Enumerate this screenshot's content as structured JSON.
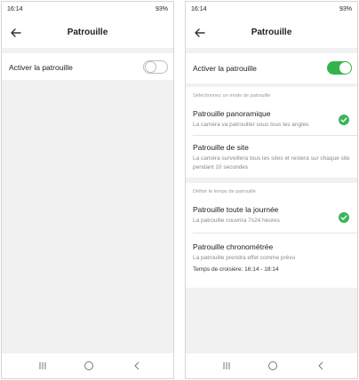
{
  "left": {
    "status": {
      "time": "16:14",
      "right": "93%"
    },
    "header": {
      "title": "Patrouille"
    },
    "patrol_toggle": {
      "label": "Activer la patrouille",
      "state": "off"
    }
  },
  "right": {
    "status": {
      "time": "16:14",
      "right": "93%"
    },
    "header": {
      "title": "Patrouille"
    },
    "patrol_toggle": {
      "label": "Activer la patrouille",
      "state": "on"
    },
    "mode_section": {
      "label": "Sélectionnez un mode de patrouille",
      "options": [
        {
          "title": "Patrouille panoramique",
          "subtitle": "La caméra va patrouiller sous tous les angles",
          "selected": true
        },
        {
          "title": "Patrouille de site",
          "subtitle": "La caméra surveillera tous les sites et restera sur chaque site pendant 10 secondes",
          "selected": false
        }
      ]
    },
    "time_section": {
      "label": "Définir le temps de patrouille",
      "options": [
        {
          "title": "Patrouille toute la journée",
          "subtitle": "La patrouille couvrira 7x24 heures",
          "selected": true
        },
        {
          "title": "Patrouille chronométrée",
          "subtitle": "La patrouille prendra effet comme prévu",
          "cruise_label": "Temps de croisière:",
          "cruise_value": "16:14 - 18:14",
          "selected": false
        }
      ]
    }
  },
  "colors": {
    "accent": "#33b34a",
    "background": "#f1f1f1",
    "card": "#ffffff"
  }
}
